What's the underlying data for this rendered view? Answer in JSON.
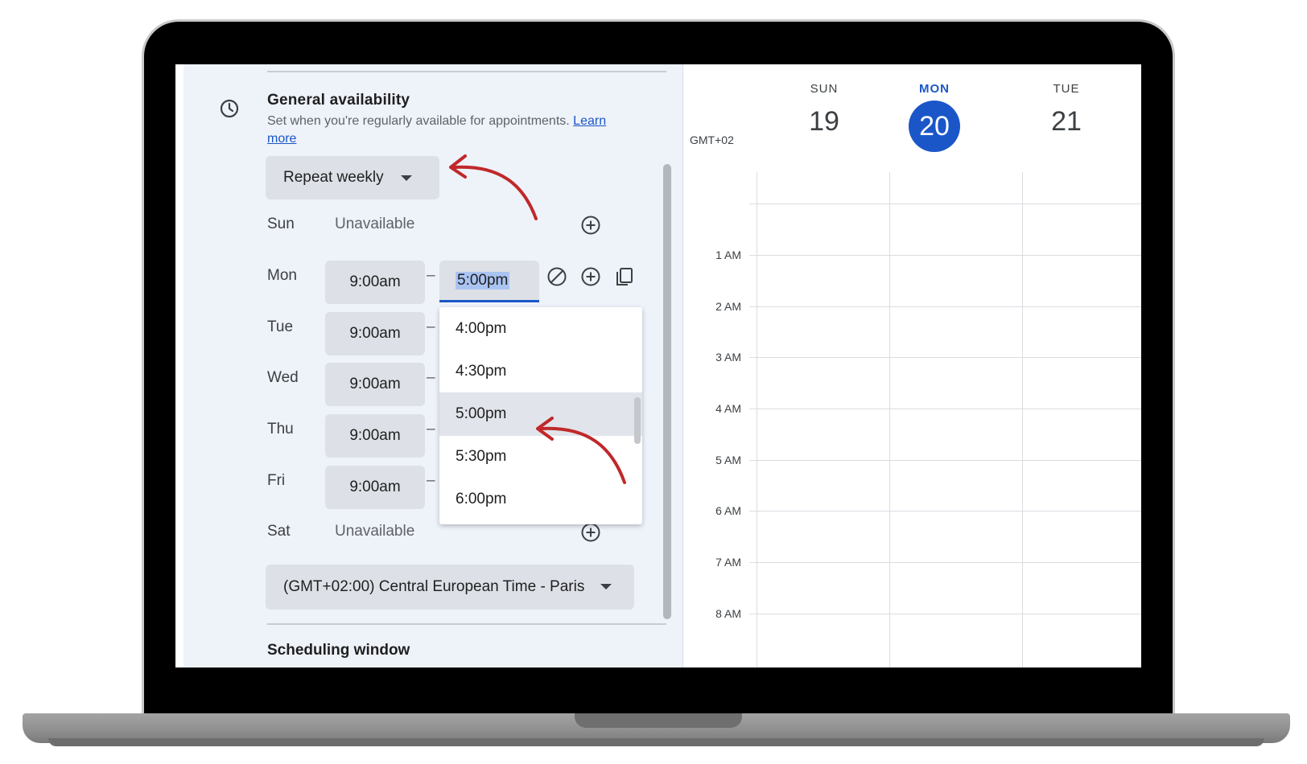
{
  "availability": {
    "title": "General availability",
    "description": "Set when you're regularly available for appointments.",
    "learn_link_part1": "Learn",
    "learn_link_part2": "more",
    "repeat_label": "Repeat weekly"
  },
  "days": [
    {
      "label": "Sun",
      "status": "Unavailable"
    },
    {
      "label": "Mon",
      "start": "9:00am",
      "end": "5:00pm"
    },
    {
      "label": "Tue",
      "start": "9:00am"
    },
    {
      "label": "Wed",
      "start": "9:00am"
    },
    {
      "label": "Thu",
      "start": "9:00am"
    },
    {
      "label": "Fri",
      "start": "9:00am"
    },
    {
      "label": "Sat",
      "status": "Unavailable"
    }
  ],
  "separator": "–",
  "time_options": [
    "4:00pm",
    "4:30pm",
    "5:00pm",
    "5:30pm",
    "6:00pm"
  ],
  "selected_time": "5:00pm",
  "timezone": "(GMT+02:00) Central European Time - Paris",
  "next_section": "Scheduling window",
  "calendar": {
    "timezone_label": "GMT+02",
    "days": [
      {
        "dow": "SUN",
        "date": "19"
      },
      {
        "dow": "MON",
        "date": "20",
        "today": true
      },
      {
        "dow": "TUE",
        "date": "21"
      }
    ],
    "hours": [
      "1 AM",
      "2 AM",
      "3 AM",
      "4 AM",
      "5 AM",
      "6 AM",
      "7 AM",
      "8 AM"
    ]
  },
  "colors": {
    "accent": "#1a56c8",
    "panel_bg": "#eef2f9",
    "annotation_arrow": "#c0282a"
  }
}
